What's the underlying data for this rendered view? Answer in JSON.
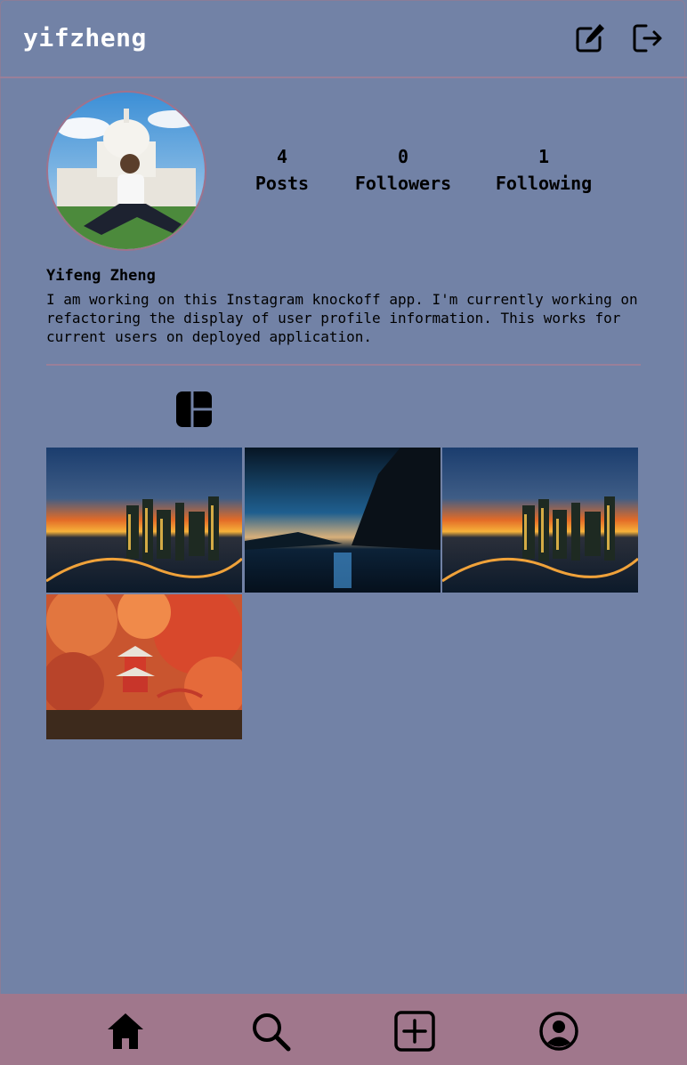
{
  "header": {
    "username": "yifzheng",
    "edit_icon": "edit-icon",
    "logout_icon": "logout-icon"
  },
  "profile": {
    "avatar_icon": "profile-photo",
    "stats": [
      {
        "value": "4",
        "label": "Posts"
      },
      {
        "value": "0",
        "label": "Followers"
      },
      {
        "value": "1",
        "label": "Following"
      }
    ],
    "full_name": "Yifeng Zheng",
    "bio": "I am working on this Instagram knockoff app. I'm currently working on refactoring the display of user profile information. This works for current users on deployed application."
  },
  "grid_toggle_icon": "grid-icon",
  "posts": [
    {
      "subject": "city-skyline-sunset"
    },
    {
      "subject": "coastal-night-cliff"
    },
    {
      "subject": "city-skyline-sunset"
    },
    {
      "subject": "autumn-pagoda"
    }
  ],
  "bottom_nav": [
    {
      "icon": "home-icon"
    },
    {
      "icon": "search-icon"
    },
    {
      "icon": "add-post-icon"
    },
    {
      "icon": "profile-icon"
    }
  ],
  "colors": {
    "background": "#7282a6",
    "nav_bar": "#a0778c",
    "divider": "#9a7f99"
  }
}
